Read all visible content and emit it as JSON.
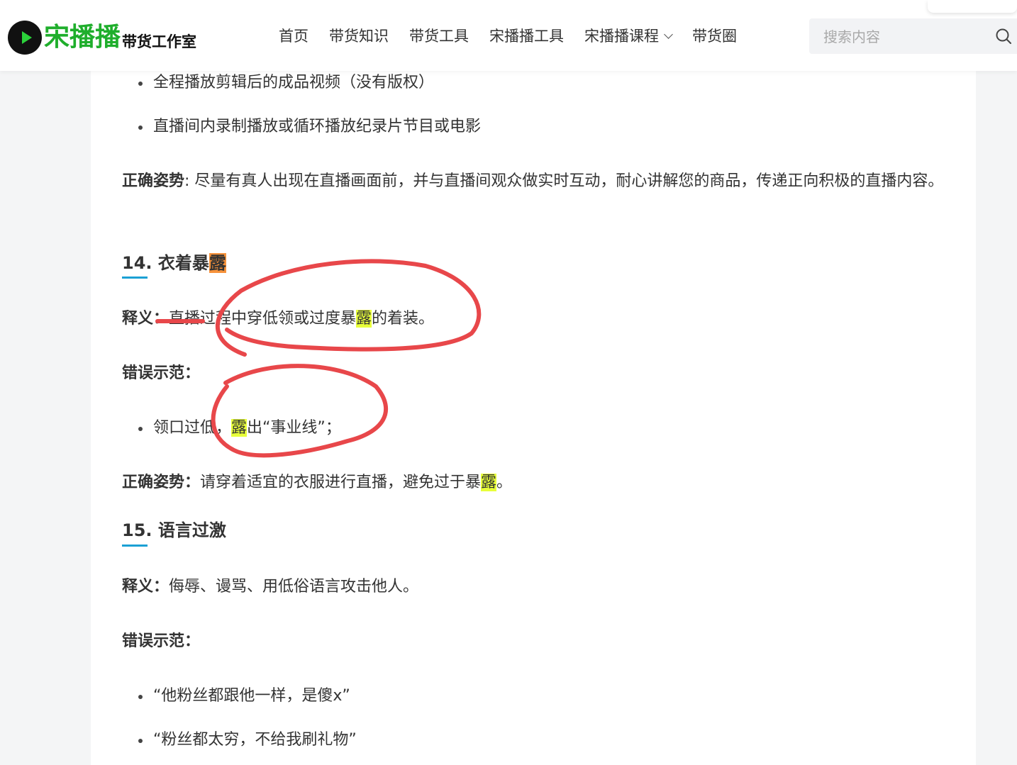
{
  "header": {
    "logo_main": "宋播播",
    "logo_sub": "带货工作室",
    "nav": [
      "首页",
      "带货知识",
      "带货工具",
      "宋播播工具",
      "宋播播课程",
      "带货圈"
    ],
    "search_placeholder": "搜索内容"
  },
  "article": {
    "top_bullets": [
      "全程播放剪辑后的成品视频（没有版权）",
      "直播间内录制播放或循环播放纪录片节目或电影"
    ],
    "correct1_label": "正确姿势",
    "correct1_text": ": 尽量有真人出现在直播画面前，并与直播间观众做实时互动，耐心讲解您的商品，传递正向积极的直播内容。",
    "s14": {
      "heading_prefix": "14. 衣着暴",
      "heading_hl": "露",
      "def_label": "释义：",
      "def_prefix": "直播过程中穿低领或过度暴",
      "def_hl": "露",
      "def_suffix": "的着装。",
      "wrong_label": "错误示范：",
      "wrong_prefix": "领口过低，",
      "wrong_hl": "露",
      "wrong_suffix": "出“事业线”；",
      "correct_label": "正确姿势：",
      "correct_prefix": "请穿着适宜的衣服进行直播，避免过于暴",
      "correct_hl": "露",
      "correct_suffix": "。"
    },
    "s15": {
      "heading": "15. 语言过激",
      "def_label": "释义：",
      "def_text": "侮辱、谩骂、用低俗语言攻击他人。",
      "wrong_label": "错误示范：",
      "bullets": [
        "“他粉丝都跟他一样，是傻x”",
        "“粉丝都太穷，不给我刷礼物”"
      ]
    }
  },
  "colors": {
    "brand_green": "#1fae2c",
    "heading_underline": "#1ba0d4",
    "highlight_yellow": "#e8ff3a",
    "highlight_orange": "#f6923b",
    "annotation_red": "#e8474a"
  }
}
